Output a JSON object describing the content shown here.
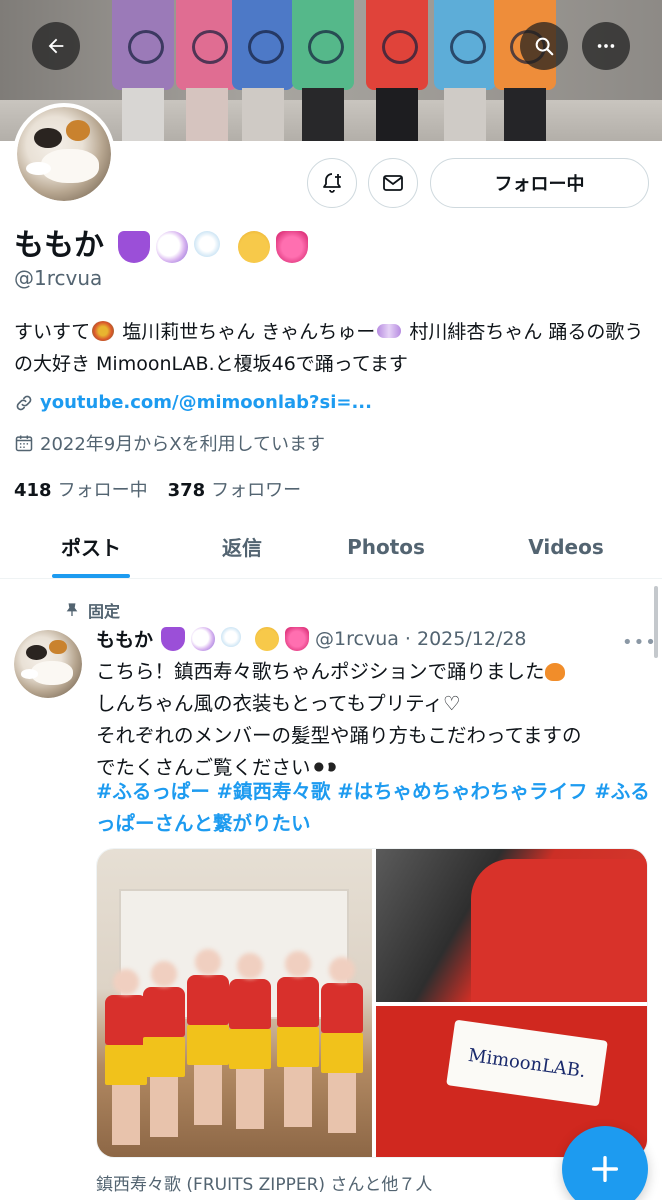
{
  "profile": {
    "display_name": "ももか",
    "handle": "@1rcvua",
    "bio": "すいすて💐 塩川莉世ちゃん きゃんちゅー🍬 村川緋杏ちゃん 踊るの歌うの大好き MimoonLAB.と榎坂46で踊ってます",
    "bio_part1": "すいすて",
    "bio_part2": " 塩川莉世ちゃん きゃんちゅー",
    "bio_part3": " 村川緋杏ちゃん 踊るの歌うの大好き MimoonLAB.と榎坂46で踊ってます",
    "link": "youtube.com/@mimoonlab?si=...",
    "joined": "2022年9月からXを利用しています",
    "following_count": "418",
    "following_label": "フォロー中",
    "followers_count": "378",
    "followers_label": "フォロワー"
  },
  "actions": {
    "follow_label": "フォロー中",
    "notify_icon": "bell-plus-icon",
    "message_icon": "envelope-icon"
  },
  "tabs": [
    {
      "label": "ポスト",
      "active": true
    },
    {
      "label": "返信",
      "active": false
    },
    {
      "label": "Photos",
      "active": false
    },
    {
      "label": "Videos",
      "active": false
    }
  ],
  "pinned_post": {
    "pinned_label": "固定",
    "author": "ももか",
    "handle_date": "@1rcvua · 2025/12/28",
    "lines": [
      "こちら！鎮西寿々歌ちゃんポジションで踊りました",
      "しんちゃん風の衣装もとってもプリティ♡",
      "それぞれのメンバーの髪型や踊り方もこだわってますの",
      "でたくさんご覧ください"
    ],
    "hashtags": "#ふるっぱー #鎮西寿々歌 #はちゃめちゃわちゃライフ #ふるっぱーさんと繋がりたい",
    "patch_text": "MimoonLAB.",
    "tagged": "鎮西寿々歌 (FRUITS ZIPPER) さんと他７人"
  },
  "colors": {
    "accent": "#1d9bf0",
    "secondary_text": "#536471",
    "primary_text": "#0f1419",
    "border": "#cfd9de"
  }
}
